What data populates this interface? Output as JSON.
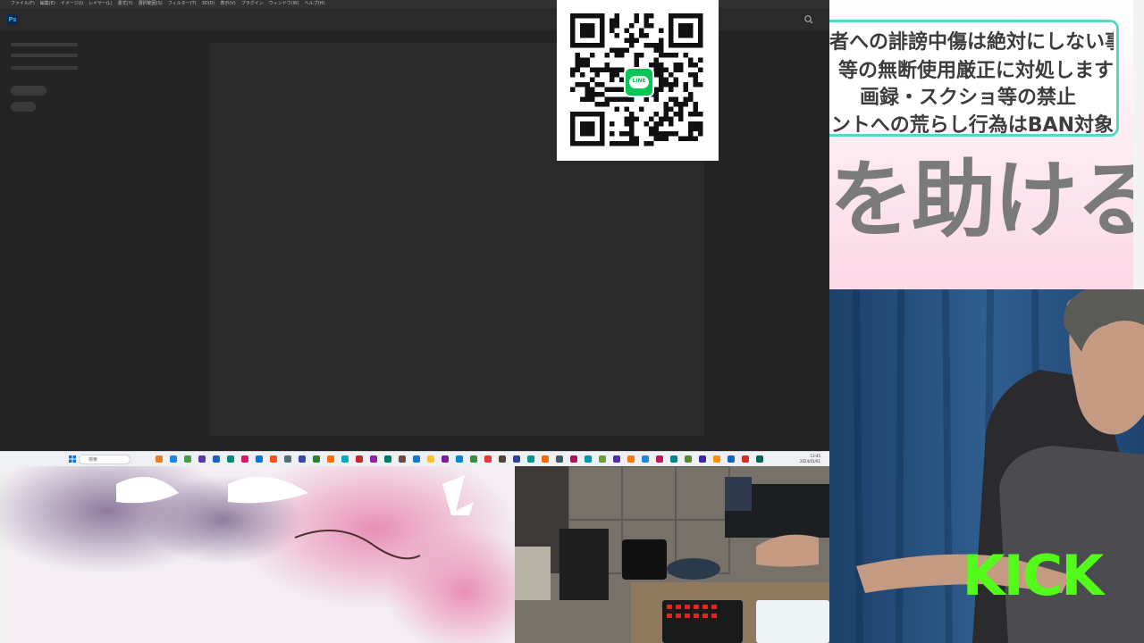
{
  "photoshop": {
    "menu_items": [
      "ファイル(F)",
      "編集(E)",
      "イメージ(I)",
      "レイヤー(L)",
      "書式(Y)",
      "選択範囲(S)",
      "フィルター(T)",
      "3D(D)",
      "表示(V)",
      "プラグイン",
      "ウィンドウ(W)",
      "ヘルプ(H)"
    ],
    "logo": "Ps"
  },
  "taskbar": {
    "search_placeholder": "検索",
    "clock_time": "13:45",
    "clock_date": "2024/01/01"
  },
  "qr": {
    "badge": "LINE"
  },
  "rules": {
    "lines": [
      "者への誹謗中傷は絶対にしない事",
      "等の無断使用厳正に対処します",
      "画録・スクショ等の禁止",
      "ントへの荒らし行為はBAN対象"
    ],
    "headline": "を助ける"
  },
  "overlay": {
    "kick_logo": "KICK"
  },
  "colors": {
    "rules_border": "#52d8c4",
    "kick_green": "#53fc18",
    "line_green": "#06c755"
  },
  "icons": {
    "search": "search-icon",
    "windows": "windows-start-icon",
    "ps": "photoshop-logo-icon"
  }
}
